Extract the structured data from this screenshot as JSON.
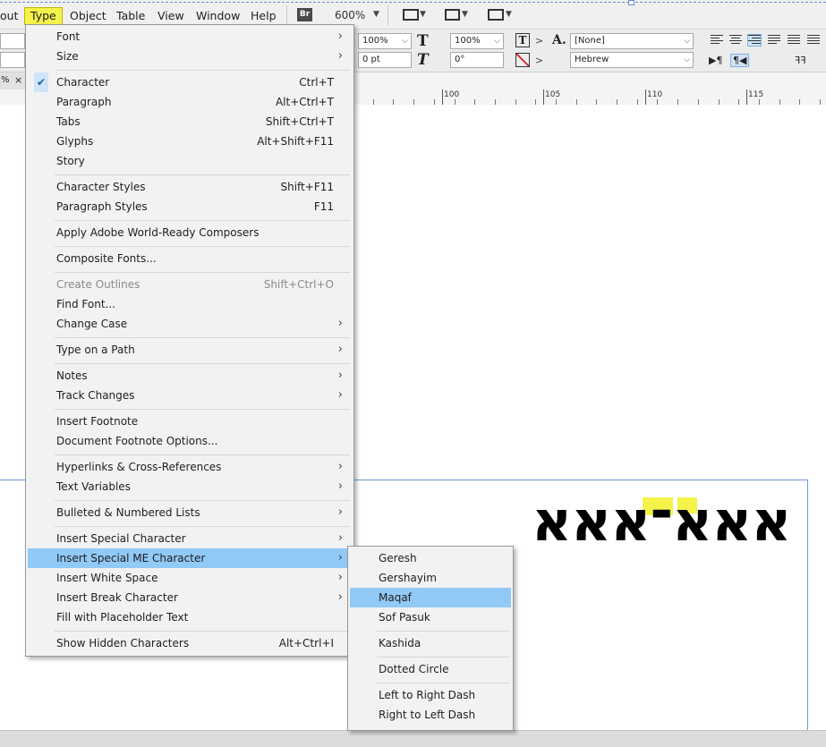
{
  "menubar": {
    "items": [
      "out",
      "Type",
      "Object",
      "Table",
      "View",
      "Window",
      "Help"
    ],
    "bridge_label": "Br",
    "zoom": "600%"
  },
  "control": {
    "hscale": "100%",
    "vscale": "100%",
    "baseline": "0 pt",
    "skew": "0°",
    "char_style": "[None]",
    "language": "Hebrew"
  },
  "ruler": {
    "ticks": [
      "100",
      "105",
      "110",
      "115"
    ]
  },
  "tab": {
    "percent": "%",
    "close": "×"
  },
  "document": {
    "text": "אאא־אאא"
  },
  "type_menu": {
    "items": [
      {
        "label": "Font",
        "shortcut": "",
        "submenu": true
      },
      {
        "label": "Size",
        "shortcut": "",
        "submenu": true
      },
      {
        "label": "Character",
        "shortcut": "Ctrl+T",
        "checked": true
      },
      {
        "label": "Paragraph",
        "shortcut": "Alt+Ctrl+T"
      },
      {
        "label": "Tabs",
        "shortcut": "Shift+Ctrl+T"
      },
      {
        "label": "Glyphs",
        "shortcut": "Alt+Shift+F11"
      },
      {
        "label": "Story",
        "shortcut": ""
      },
      {
        "label": "Character Styles",
        "shortcut": "Shift+F11"
      },
      {
        "label": "Paragraph Styles",
        "shortcut": "F11"
      },
      {
        "label": "Apply Adobe World-Ready Composers",
        "shortcut": ""
      },
      {
        "label": "Composite Fonts...",
        "shortcut": ""
      },
      {
        "label": "Create Outlines",
        "shortcut": "Shift+Ctrl+O",
        "disabled": true
      },
      {
        "label": "Find Font...",
        "shortcut": ""
      },
      {
        "label": "Change Case",
        "shortcut": "",
        "submenu": true
      },
      {
        "label": "Type on a Path",
        "shortcut": "",
        "submenu": true
      },
      {
        "label": "Notes",
        "shortcut": "",
        "submenu": true
      },
      {
        "label": "Track Changes",
        "shortcut": "",
        "submenu": true
      },
      {
        "label": "Insert Footnote",
        "shortcut": ""
      },
      {
        "label": "Document Footnote Options...",
        "shortcut": ""
      },
      {
        "label": "Hyperlinks & Cross-References",
        "shortcut": "",
        "submenu": true
      },
      {
        "label": "Text Variables",
        "shortcut": "",
        "submenu": true
      },
      {
        "label": "Bulleted & Numbered Lists",
        "shortcut": "",
        "submenu": true
      },
      {
        "label": "Insert Special Character",
        "shortcut": "",
        "submenu": true
      },
      {
        "label": "Insert Special ME Character",
        "shortcut": "",
        "submenu": true,
        "highlighted": true
      },
      {
        "label": "Insert White Space",
        "shortcut": "",
        "submenu": true
      },
      {
        "label": "Insert Break Character",
        "shortcut": "",
        "submenu": true
      },
      {
        "label": "Fill with Placeholder Text",
        "shortcut": ""
      },
      {
        "label": "Show Hidden Characters",
        "shortcut": "Alt+Ctrl+I"
      }
    ]
  },
  "sub_menu": {
    "items": [
      {
        "label": "Geresh"
      },
      {
        "label": "Gershayim"
      },
      {
        "label": "Maqaf",
        "highlighted": true
      },
      {
        "label": "Sof Pasuk"
      },
      {
        "label": "Kashida"
      },
      {
        "label": "Dotted Circle"
      },
      {
        "label": "Left to Right Dash"
      },
      {
        "label": "Right to Left Dash"
      }
    ]
  },
  "colors": {
    "highlight": "#91c9f7",
    "type_menu_highlight": "#f5f24a",
    "frame_edge": "#6b9ad8"
  }
}
